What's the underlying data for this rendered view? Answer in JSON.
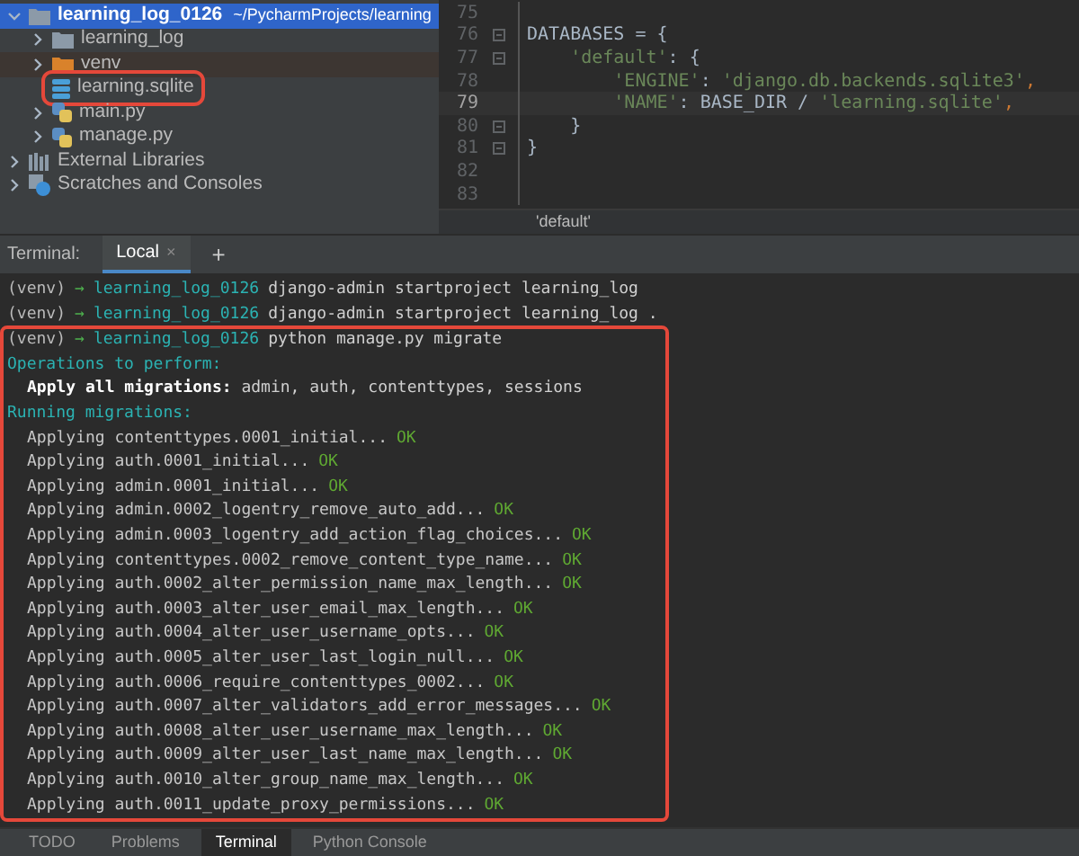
{
  "project_tree": {
    "items": [
      {
        "label": "learning_log_0126",
        "path": "~/PycharmProjects/learning",
        "kind": "folder",
        "expanded": true,
        "selected": true,
        "highlighted": false,
        "children": [
          {
            "label": "learning_log",
            "kind": "folder",
            "expanded": false,
            "selected": false,
            "highlighted": false
          },
          {
            "label": "venv",
            "kind": "excluded-folder",
            "expanded": false,
            "selected": false,
            "highlighted": false
          },
          {
            "label": "learning.sqlite",
            "kind": "database",
            "selected": false,
            "highlighted": true
          },
          {
            "label": "main.py",
            "kind": "python",
            "expanded": false,
            "selected": false,
            "highlighted": false
          },
          {
            "label": "manage.py",
            "kind": "python",
            "expanded": false,
            "selected": false,
            "highlighted": false
          }
        ]
      },
      {
        "label": "External Libraries",
        "kind": "libraries",
        "expanded": false,
        "selected": false,
        "highlighted": false
      },
      {
        "label": "Scratches and Consoles",
        "kind": "scratches",
        "expanded": false,
        "selected": false,
        "highlighted": false
      }
    ]
  },
  "editor": {
    "lines": [
      {
        "number": "75",
        "current": false,
        "fold": false
      },
      {
        "number": "76",
        "current": false,
        "fold": true,
        "tokens": [
          {
            "kind": "plain",
            "text": "DATABASES = {"
          }
        ]
      },
      {
        "number": "77",
        "current": false,
        "fold": true,
        "tokens": [
          {
            "kind": "string",
            "text": "    'default'"
          },
          {
            "kind": "plain",
            "text": ": {"
          }
        ]
      },
      {
        "number": "78",
        "current": false,
        "fold": false,
        "tokens": [
          {
            "kind": "string",
            "text": "        'ENGINE'"
          },
          {
            "kind": "plain",
            "text": ": "
          },
          {
            "kind": "string",
            "text": "'django.db.backends.sqlite3'"
          },
          {
            "kind": "punct",
            "text": ","
          }
        ]
      },
      {
        "number": "79",
        "current": true,
        "fold": false,
        "tokens": [
          {
            "kind": "string",
            "text": "        'NAME'"
          },
          {
            "kind": "plain",
            "text": ": BASE_DIR / "
          },
          {
            "kind": "string",
            "text": "'learning.sqlite'"
          },
          {
            "kind": "punct",
            "text": ","
          }
        ]
      },
      {
        "number": "80",
        "current": false,
        "fold": true,
        "tokens": [
          {
            "kind": "plain",
            "text": "    }"
          }
        ]
      },
      {
        "number": "81",
        "current": false,
        "fold": true,
        "tokens": [
          {
            "kind": "plain",
            "text": "}"
          }
        ]
      },
      {
        "number": "82",
        "current": false,
        "fold": false
      },
      {
        "number": "83",
        "current": false,
        "fold": false
      }
    ],
    "breadcrumb": "'default'"
  },
  "terminal": {
    "label": "Terminal:",
    "tabs": [
      {
        "label": "Local",
        "close": "×",
        "selected": true
      }
    ],
    "add": "+",
    "blocks": [
      {
        "highlighted": false,
        "lines": [
          {
            "kind": "prompt",
            "venv": "(venv)",
            "arrow": "→",
            "dir": "learning_log_0126",
            "command": "django-admin startproject learning_log"
          },
          {
            "kind": "prompt",
            "venv": "(venv)",
            "arrow": "→",
            "dir": "learning_log_0126",
            "command": "django-admin startproject learning_log ."
          }
        ]
      },
      {
        "highlighted": true,
        "lines": [
          {
            "kind": "prompt",
            "venv": "(venv)",
            "arrow": "→",
            "dir": "learning_log_0126",
            "command": "python manage.py migrate"
          },
          {
            "kind": "heading",
            "text": "Operations to perform:"
          },
          {
            "kind": "item",
            "label": "Apply all migrations:",
            "text": "admin, auth, contenttypes, sessions"
          },
          {
            "kind": "heading",
            "text": "Running migrations:"
          },
          {
            "kind": "applying",
            "text": "Applying contenttypes.0001_initial...",
            "status": "OK"
          },
          {
            "kind": "applying",
            "text": "Applying auth.0001_initial...",
            "status": "OK"
          },
          {
            "kind": "applying",
            "text": "Applying admin.0001_initial...",
            "status": "OK"
          },
          {
            "kind": "applying",
            "text": "Applying admin.0002_logentry_remove_auto_add...",
            "status": "OK"
          },
          {
            "kind": "applying",
            "text": "Applying admin.0003_logentry_add_action_flag_choices...",
            "status": "OK"
          },
          {
            "kind": "applying",
            "text": "Applying contenttypes.0002_remove_content_type_name...",
            "status": "OK"
          },
          {
            "kind": "applying",
            "text": "Applying auth.0002_alter_permission_name_max_length...",
            "status": "OK"
          },
          {
            "kind": "applying",
            "text": "Applying auth.0003_alter_user_email_max_length...",
            "status": "OK"
          },
          {
            "kind": "applying",
            "text": "Applying auth.0004_alter_user_username_opts...",
            "status": "OK"
          },
          {
            "kind": "applying",
            "text": "Applying auth.0005_alter_user_last_login_null...",
            "status": "OK"
          },
          {
            "kind": "applying",
            "text": "Applying auth.0006_require_contenttypes_0002...",
            "status": "OK"
          },
          {
            "kind": "applying",
            "text": "Applying auth.0007_alter_validators_add_error_messages...",
            "status": "OK"
          },
          {
            "kind": "applying",
            "text": "Applying auth.0008_alter_user_username_max_length...",
            "status": "OK"
          },
          {
            "kind": "applying",
            "text": "Applying auth.0009_alter_user_last_name_max_length...",
            "status": "OK"
          },
          {
            "kind": "applying",
            "text": "Applying auth.0010_alter_group_name_max_length...",
            "status": "OK"
          },
          {
            "kind": "applying",
            "text": "Applying auth.0011_update_proxy_permissions...",
            "status": "OK"
          }
        ]
      }
    ]
  },
  "tool_tabs": [
    {
      "label": "TODO",
      "selected": false
    },
    {
      "label": "Problems",
      "selected": false
    },
    {
      "label": "Terminal",
      "selected": true
    },
    {
      "label": "Python Console",
      "selected": false
    }
  ]
}
